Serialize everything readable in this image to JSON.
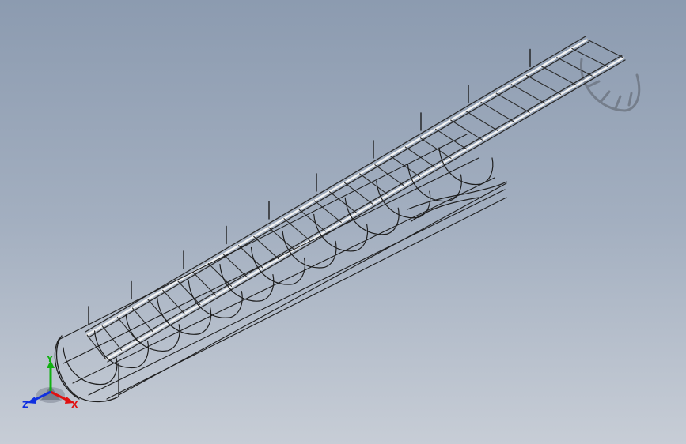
{
  "viewport": {
    "background_top": "#8c9bb0",
    "background_bottom": "#c7cdd6",
    "model_description_icon": "wireframe-ladder-cage-icon"
  },
  "triad": {
    "x_label": "X",
    "y_label": "Y",
    "z_label": "Z",
    "x_color": "#e01010",
    "y_color": "#10b010",
    "z_color": "#1030e0"
  }
}
